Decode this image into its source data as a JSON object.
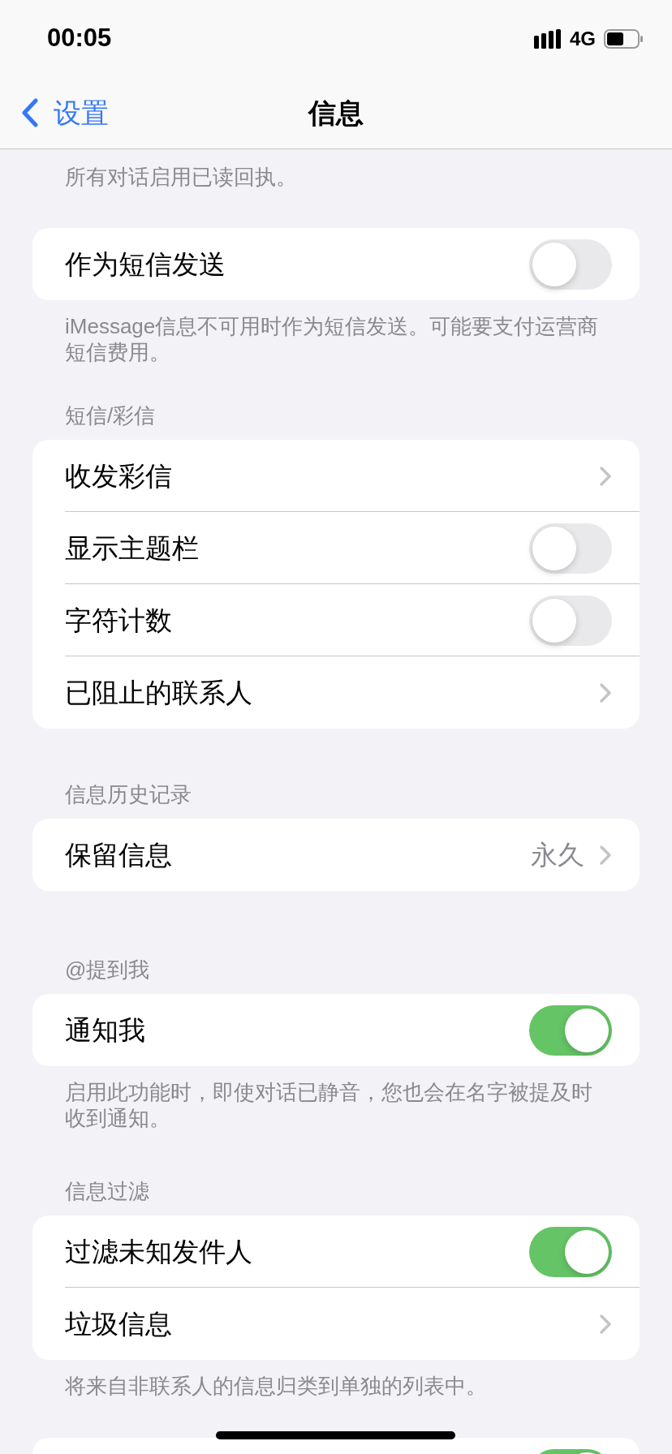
{
  "status_bar": {
    "time": "00:05",
    "network": "4G"
  },
  "nav": {
    "back": "设置",
    "title": "信息"
  },
  "sections": [
    {
      "footer": "所有对话启用已读回执。"
    },
    {
      "rows": [
        {
          "kind": "toggle",
          "label": "作为短信发送",
          "on": false
        }
      ],
      "footer": "iMessage信息不可用时作为短信发送。可能要支付运营商短信费用。"
    },
    {
      "header": "短信/彩信",
      "rows": [
        {
          "kind": "link",
          "label": "收发彩信"
        },
        {
          "kind": "toggle",
          "label": "显示主题栏",
          "on": false
        },
        {
          "kind": "toggle",
          "label": "字符计数",
          "on": false
        },
        {
          "kind": "link",
          "label": "已阻止的联系人"
        }
      ]
    },
    {
      "header": "信息历史记录",
      "rows": [
        {
          "kind": "link",
          "label": "保留信息",
          "value": "永久"
        }
      ]
    },
    {
      "header": "@提到我",
      "rows": [
        {
          "kind": "toggle",
          "label": "通知我",
          "on": true
        }
      ],
      "footer": "启用此功能时，即使对话已静音，您也会在名字被提及时收到通知。"
    },
    {
      "header": "信息过滤",
      "rows": [
        {
          "kind": "toggle",
          "label": "过滤未知发件人",
          "on": true
        },
        {
          "kind": "link",
          "label": "垃圾信息"
        }
      ],
      "footer": "将来自非联系人的信息归类到单独的列表中。"
    },
    {
      "rows": [
        {
          "kind": "toggle",
          "on": true
        }
      ]
    }
  ]
}
